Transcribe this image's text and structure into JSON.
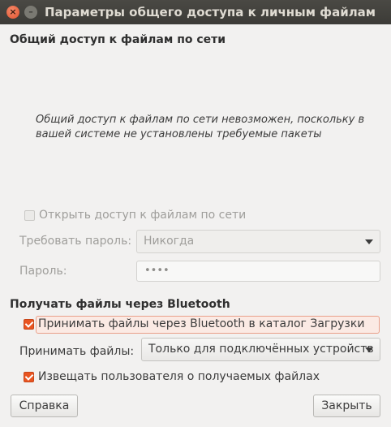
{
  "window": {
    "title": "Параметры общего доступа к личным файлам",
    "close_symbol": "×",
    "minimize_symbol": "–"
  },
  "network_sharing": {
    "heading": "Общий доступ к файлам по сети",
    "notice_line1": "Общий доступ к файлам по сети невозможен, поскольку в",
    "notice_line2": "вашей системе не установлены требуемые пакеты",
    "share_checkbox_label": "Открыть доступ к файлам по сети",
    "share_checked": false,
    "require_password_label": "Требовать пароль:",
    "require_password_value": "Никогда",
    "password_label": "Пароль:",
    "password_value": "••••"
  },
  "bluetooth": {
    "heading": "Получать файлы через Bluetooth",
    "receive_checkbox_label": "Принимать файлы через Bluetooth в каталог Загрузки",
    "receive_checked": true,
    "accept_label": "Принимать файлы:",
    "accept_value": "Только для подключённых устройств",
    "notify_checkbox_label": "Извещать пользователя о получаемых файлах",
    "notify_checked": true
  },
  "buttons": {
    "help": "Справка",
    "close": "Закрыть"
  },
  "colors": {
    "accent": "#e95420",
    "titlebar": "#3c3b37",
    "background": "#f2f1f0"
  }
}
